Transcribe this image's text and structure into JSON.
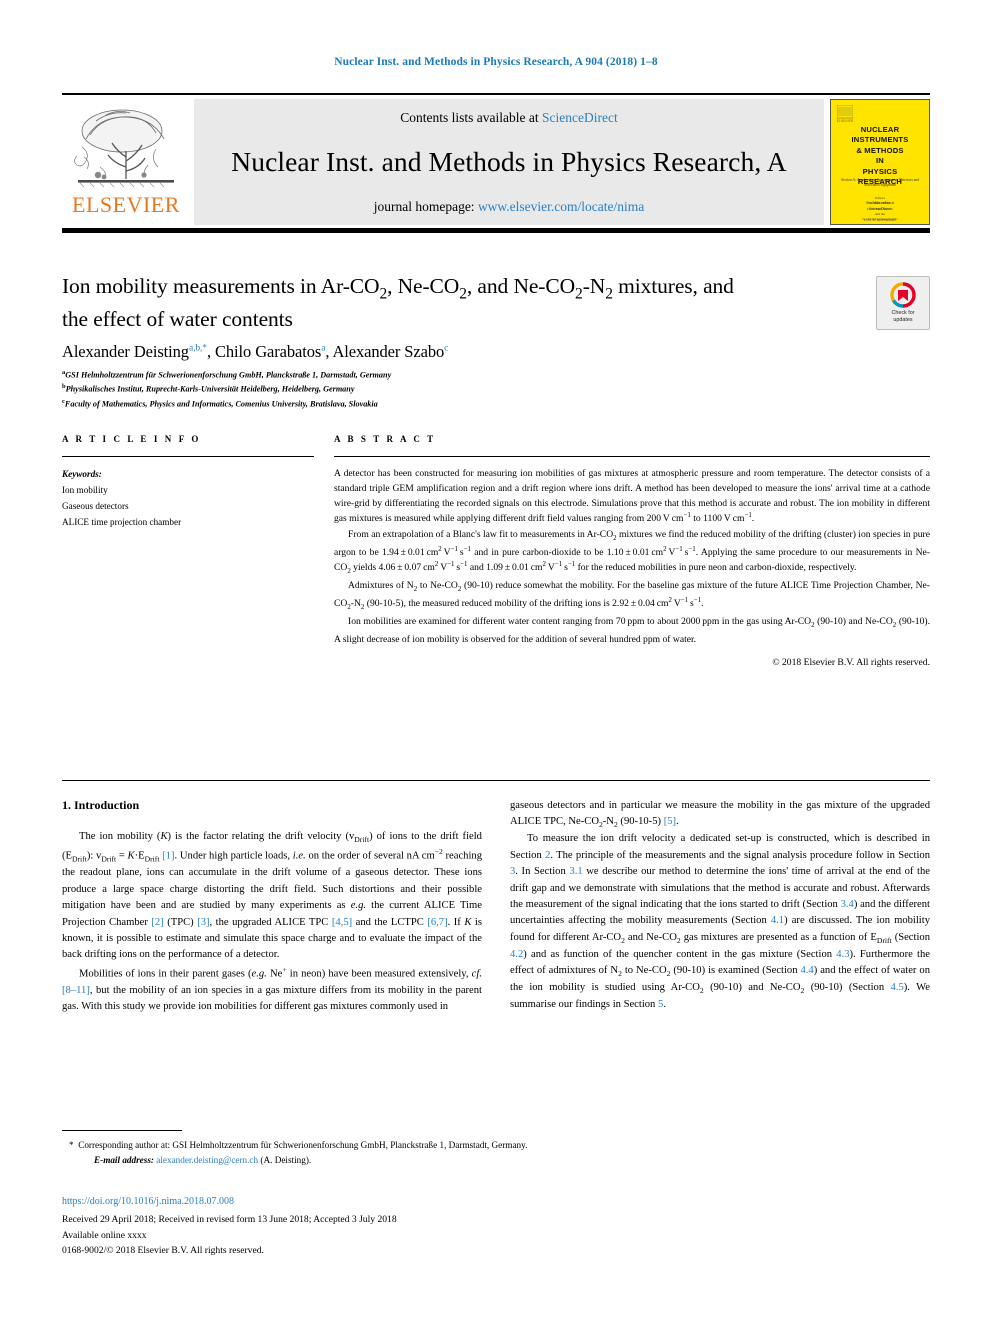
{
  "running_head": "Nuclear Inst. and Methods in Physics Research, A 904 (2018) 1–8",
  "masthead": {
    "publisher_logo_text": "ELSEVIER",
    "contents_prefix": "Contents lists available at ",
    "contents_link": "ScienceDirect",
    "journal_name": "Nuclear Inst. and Methods in Physics Research, A",
    "homepage_prefix": "journal homepage: ",
    "homepage_link": "www.elsevier.com/locate/nima",
    "cover": {
      "title_lines": [
        "NUCLEAR",
        "INSTRUMENTS",
        "& METHODS",
        "IN",
        "PHYSICS",
        "RESEARCH"
      ],
      "subtitle": "Section A: Accelerators, Spectrometers, Detectors and Associated Equipment",
      "editors": "Editors\nW. BARLETTA\nD. M. FRANÇOIS\nand the\nD. H. H. HOFFMANN\nW. MITTIG\nJ. M. POATE\nR. T. W. LONGO\nH. S. PADAMSEE",
      "footer": "Available online at\nScienceDirect",
      "footer2": "ELSEVIER    ISSN 0168-9002"
    }
  },
  "article": {
    "title": "Ion mobility measurements in Ar-CO₂, Ne-CO₂, and Ne-CO₂-N₂ mixtures, and the effect of water contents",
    "authors": [
      {
        "name": "Alexander Deisting",
        "marks": "a,b,*"
      },
      {
        "name": "Chilo Garabatos",
        "marks": "a"
      },
      {
        "name": "Alexander Szabo",
        "marks": "c"
      }
    ],
    "affiliations": [
      {
        "mark": "a",
        "text": "GSI Helmholtzzentrum für Schwerionenforschung GmbH, Planckstraße 1, Darmstadt, Germany"
      },
      {
        "mark": "b",
        "text": "Physikalisches Institut, Ruprecht-Karls-Universität Heidelberg, Heidelberg, Germany"
      },
      {
        "mark": "c",
        "text": "Faculty of Mathematics, Physics and Informatics, Comenius University, Bratislava, Slovakia"
      }
    ],
    "crossmark_label": "Check for\nupdates"
  },
  "info": {
    "heading": "A R T I C L E   I N F O",
    "keywords_label": "Keywords:",
    "keywords": [
      "Ion mobility",
      "Gaseous detectors",
      "ALICE time projection chamber"
    ]
  },
  "abstract": {
    "heading": "A B S T R A C T",
    "paragraphs": [
      "A detector has been constructed for measuring ion mobilities of gas mixtures at atmospheric pressure and room temperature. The detector consists of a standard triple GEM amplification region and a drift region where ions drift. A method has been developed to measure the ions' arrival time at a cathode wire-grid by differentiating the recorded signals on this electrode. Simulations prove that this method is accurate and robust. The ion mobility in different gas mixtures is measured while applying different drift field values ranging from 200 V cm⁻¹ to 1100 V cm⁻¹.",
      "From an extrapolation of a Blanc's law fit to measurements in Ar-CO₂ mixtures we find the reduced mobility of the drifting (cluster) ion species in pure argon to be 1.94 ± 0.01 cm² V⁻¹ s⁻¹ and in pure carbon-dioxide to be 1.10 ± 0.01 cm² V⁻¹ s⁻¹. Applying the same procedure to our measurements in Ne-CO₂ yields 4.06 ± 0.07 cm² V⁻¹ s⁻¹ and 1.09 ± 0.01 cm² V⁻¹ s⁻¹ for the reduced mobilities in pure neon and carbon-dioxide, respectively.",
      "Admixtures of N₂ to Ne-CO₂ (90-10) reduce somewhat the mobility. For the baseline gas mixture of the future ALICE Time Projection Chamber, Ne-CO₂-N₂ (90-10-5), the measured reduced mobility of the drifting ions is 2.92 ± 0.04 cm² V⁻¹ s⁻¹.",
      "Ion mobilities are examined for different water content ranging from 70 ppm to about 2000 ppm in the gas using Ar-CO₂ (90-10) and Ne-CO₂ (90-10). A slight decrease of ion mobility is observed for the addition of several hundred ppm of water."
    ],
    "copyright": "© 2018 Elsevier B.V. All rights reserved."
  },
  "body": {
    "section_heading": "1. Introduction",
    "left_paragraphs": [
      "The ion mobility (K) is the factor relating the drift velocity (v_Drift) of ions to the drift field (E_Drift): v_Drift = K·E_Drift [1]. Under high particle loads, i.e. on the order of several nA cm⁻² reaching the readout plane, ions can accumulate in the drift volume of a gaseous detector. These ions produce a large space charge distorting the drift field. Such distortions and their possible mitigation have been and are studied by many experiments as e.g. the current ALICE Time Projection Chamber [2] (TPC) [3], the upgraded ALICE TPC [4,5] and the LCTPC [6,7]. If K is known, it is possible to estimate and simulate this space charge and to evaluate the impact of the back drifting ions on the performance of a detector.",
      "Mobilities of ions in their parent gases (e.g. Ne⁺ in neon) have been measured extensively, cf. [8–11], but the mobility of an ion species in a gas mixture differs from its mobility in the parent gas. With this study we provide ion mobilities for different gas mixtures commonly used in"
    ],
    "right_paragraphs": [
      "gaseous detectors and in particular we measure the mobility in the gas mixture of the upgraded ALICE TPC, Ne-CO₂-N₂ (90-10-5) [5].",
      "To measure the ion drift velocity a dedicated set-up is constructed, which is described in Section 2. The principle of the measurements and the signal analysis procedure follow in Section 3. In Section 3.1 we describe our method to determine the ions' time of arrival at the end of the drift gap and we demonstrate with simulations that the method is accurate and robust. Afterwards the measurement of the signal indicating that the ions started to drift (Section 3.4) and the different uncertainties affecting the mobility measurements (Section 4.1) are discussed. The ion mobility found for different Ar-CO₂ and Ne-CO₂ gas mixtures are presented as a function of E_Drift (Section 4.2) and as function of the quencher content in the gas mixture (Section 4.3). Furthermore the effect of admixtures of N₂ to Ne-CO₂ (90-10) is examined (Section 4.4) and the effect of water on the ion mobility is studied using Ar-CO₂ (90-10) and Ne-CO₂ (90-10) (Section 4.5). We summarise our findings in Section 5."
    ]
  },
  "footer": {
    "corresponding_mark": "*",
    "corresponding_text": "Corresponding author at: GSI Helmholtzzentrum für Schwerionenforschung GmbH, Planckstraße 1, Darmstadt, Germany.",
    "email_label": "E-mail address:",
    "email": "alexander.deisting@cern.ch",
    "email_suffix": "(A. Deisting).",
    "doi": "https://doi.org/10.1016/j.nima.2018.07.008",
    "dates": "Received 29 April 2018; Received in revised form 13 June 2018; Accepted 3 July 2018",
    "available": "Available online xxxx",
    "issn_line": "0168-9002/© 2018 Elsevier B.V. All rights reserved."
  },
  "colors": {
    "link": "#2a7fc1",
    "elsevier_orange": "#E87722",
    "cover_yellow": "#FFE400",
    "runhead": "#1a7bb9"
  }
}
